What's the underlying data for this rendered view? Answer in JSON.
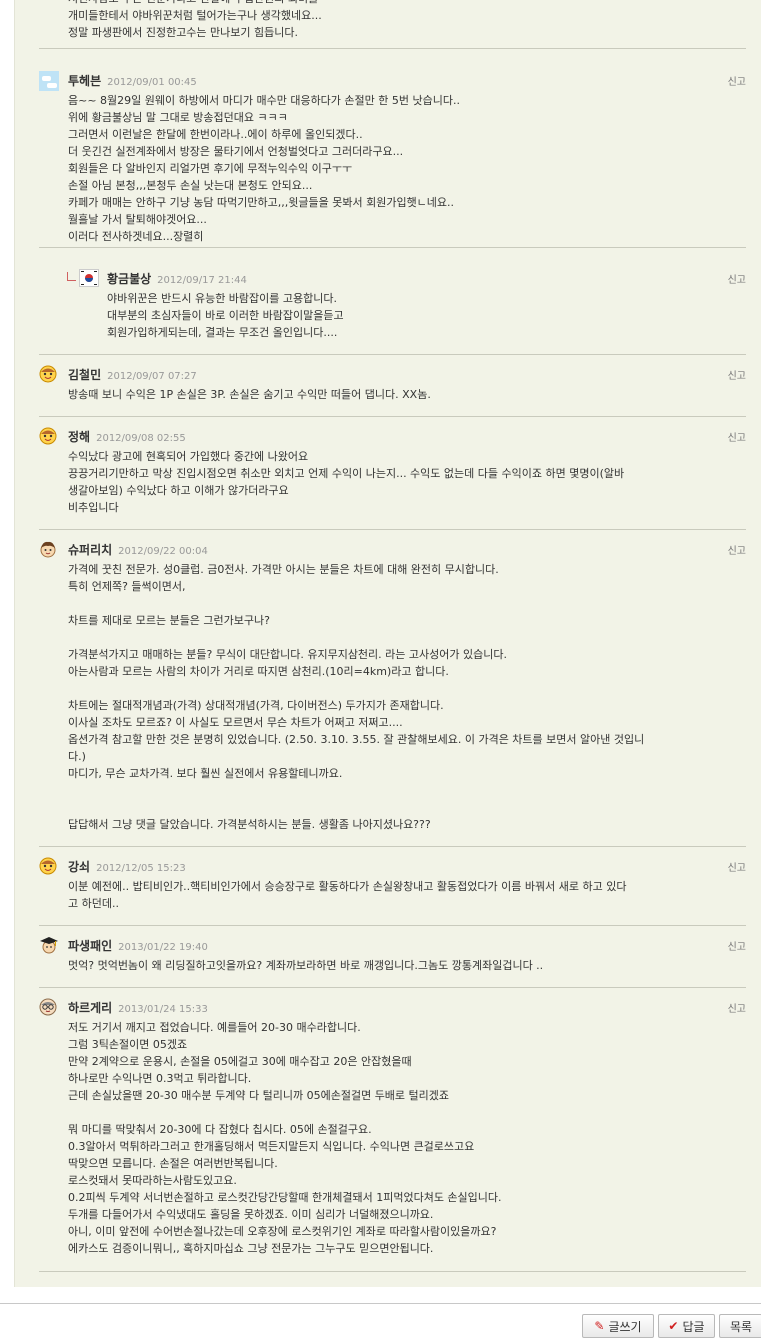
{
  "report_label": "신고",
  "comments": [
    {
      "nick": "",
      "date": "",
      "avatar": "none",
      "lines": [
        "저런사람도 무슨 전문가라고 한달에 수십만원의 회비를",
        "개미들한테서 야바위꾼처럼 털어가는구나 생각했네요...",
        "정말 파생판에서 진정한고수는 만나보기 힘듭니다."
      ]
    },
    {
      "nick": "투헤븐",
      "date": "2012/09/01 00:45",
      "avatar": "sky",
      "lines": [
        "음~~ 8월29일 원웨이 하방에서 마디가 매수만 대응하다가 손절만 한 5번 낫습니다..",
        "위에 황금불상님 말 그대로 방송접던대요 ㅋㅋㅋ",
        "그러면서 이런날은 한달에 한번이라나..에이 하루에 올인되겠다..",
        "더 웃긴건 실전계좌에서 방장은 물타기에서 언청벌엇다고 그러더라구요...",
        "회원들은 다 알바인지 리얼가면 후기에 무적누익수익 이구ㅜㅜ",
        "손절 아님 본청,,,본청두 손실 낫는대 본청도 안되요...",
        "카페가 매매는 안하구 기냥 농담 따먹기만하고,,,윗글들을 못봐서 회원가입햇ㄴ네요..",
        "월흘날 가서 탈퇴해야겟어요...",
        "이러다 전사하겟네요...장렬히"
      ]
    },
    {
      "nick": "황금불상",
      "date": "2012/09/17 21:44",
      "avatar": "flag",
      "reply": true,
      "lines": [
        "야바위꾼은 반드시 유능한 바람잡이를 고용합니다.",
        "대부분의 초심자들이 바로 이러한 바람잡이말을듣고",
        "회원가입하게되는데, 결과는 무조건 올인입니다...."
      ]
    },
    {
      "nick": "김철민",
      "date": "2012/09/07 07:27",
      "avatar": "face",
      "lines": [
        "방송때 보니 수익은 1P 손실은 3P. 손실은 숨기고 수익만 떠들어 댑니다. XX놈."
      ]
    },
    {
      "nick": "정해",
      "date": "2012/09/08 02:55",
      "avatar": "face",
      "lines": [
        "수익났다 광고에 현혹되어 가입했다 중간에 나왔어요",
        "끙끙거리기만하고 막상 진입시점오면 취소만 외치고 언제 수익이 나는지... 수익도 없는데 다들 수익이죠 하면 몇명이(알바",
        "생갈아보임) 수익났다 하고 이해가 않가더라구요",
        "비추입니다"
      ]
    },
    {
      "nick": "슈퍼리치",
      "date": "2012/09/22 00:04",
      "avatar": "hair",
      "lines": [
        "가격에 꿋친 전문가. 성0클럽. 금0전사. 가격만 아시는 분들은 차트에 대해 완전히 무시합니다.",
        "특히 언제쪽? 들썩이면서,",
        "",
        "차트를 제대로 모르는 분들은 그런가보구나?",
        "",
        "가격분석가지고 매매하는 분들? 무식이 대단합니다. 유지무지삼천리. 라는 고사성어가 있습니다.",
        "아는사람과 모르는 사람의 차이가 거리로 따지면 삼천리.(10리=4km)라고 합니다.",
        "",
        "차트에는 절대적개념과(가격) 상대적개념(가격, 다이버전스) 두가지가 존재합니다.",
        "이사실 조차도 모르죠? 이 사실도 모르면서 무슨 차트가 어쩌고 저쩌고....",
        "옵션가격 참고할 만한 것은 분명히 있었습니다. (2.50. 3.10. 3.55. 잘 관찰해보세요. 이 가격은 차트를 보면서 알아낸 것입니",
        "다.)",
        "마디가, 무슨 교차가격. 보다 훨씬 실전에서 유용할테니까요.",
        "",
        "",
        "답답해서 그냥 댓글 달았습니다. 가격분석하시는 분들. 생활좀 나아지셨나요???"
      ]
    },
    {
      "nick": "강쇠",
      "date": "2012/12/05 15:23",
      "avatar": "face",
      "lines": [
        "이분 예전에.. 밥티비인가..핵티비인가에서 승승장구로 활동하다가 손실왕창내고 활동접었다가 이름 바꿔서 새로 하고 있다",
        "고 하던데.."
      ]
    },
    {
      "nick": "파생패인",
      "date": "2013/01/22 19:40",
      "avatar": "grad",
      "lines": [
        "멋억? 멋억번놈이 왜 리딩질하고잇을까요? 계좌까보라하면 바로 깨갱입니다.그놈도 깡통계좌일겁니다 .."
      ]
    },
    {
      "nick": "하르게리",
      "date": "2013/01/24 15:33",
      "avatar": "glasses",
      "lines": [
        "저도 거기서 깨지고 접었습니다. 예를들어 20-30 매수라합니다.",
        "그럼 3틱손절이면 05겠죠",
        "만약 2계약으로 운용시, 손절을 05에걸고 30에 매수잡고 20은 안잡혔을때",
        "하나로만 수익나면 0.3먹고 튀라합니다.",
        "근데 손실났을땐 20-30 매수분 두계약 다 털리니까 05에손절걸면 두배로 털리겠죠",
        "",
        "뭐 마디를 딱맞춰서 20-30에 다 잡혔다 칩시다. 05에 손절걸구요.",
        "0.3알아서 먹튀하라그러고 한개홀딩해서 먹든지말든지 식입니다. 수익나면 큰걸로쓰고요",
        "딱맞으면 모릅니다. 손절은 여러번반복됩니다.",
        "로스컷돼서 못따라하는사람도있고요.",
        "0.2피씩 두계약 서너번손절하고 로스컷간당간당할때 한개체결돼서 1피먹었다쳐도 손실입니다.",
        "두개를 다들어가서 수익냈대도 홀딩을 못하겠죠. 이미 심리가 너덜해졌으니까요.",
        "아니, 이미 앞전에 수어번손절나갔는데 오후장에 로스컷위기인 계좌로 따라할사람이있을까요?",
        "에카스도 검증이니뭐니,, 혹하지마십쇼 그냥 전문가는 그누구도 믿으면안됩니다."
      ]
    }
  ],
  "buttons": {
    "write": "글쓰기",
    "reply": "답글",
    "list": "목록"
  }
}
